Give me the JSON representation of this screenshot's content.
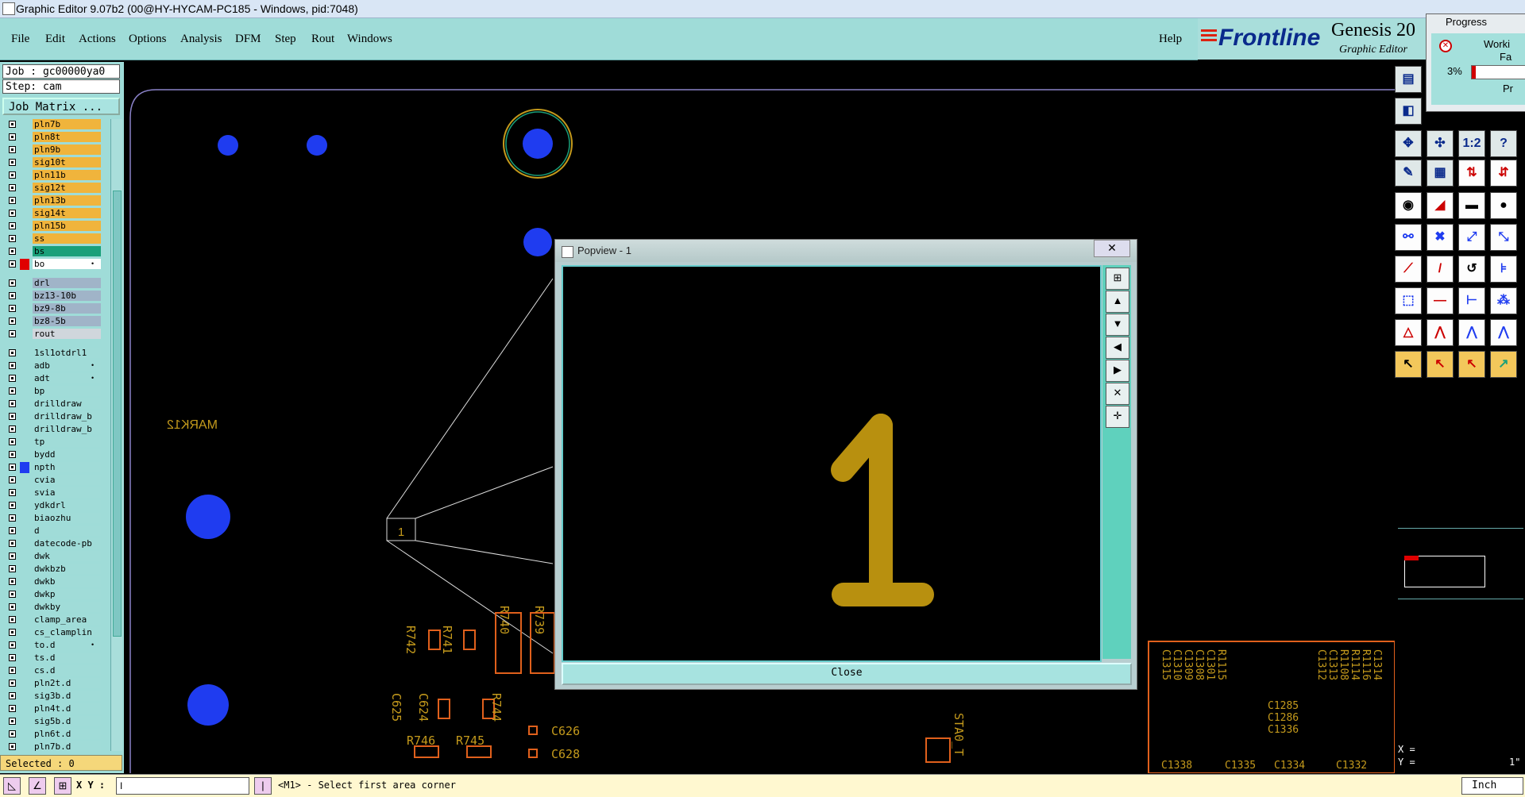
{
  "window": {
    "title": "Graphic Editor 9.07b2 (00@HY-HYCAM-PC185 - Windows, pid:7048)"
  },
  "menu": {
    "items": [
      "File",
      "Edit",
      "Actions",
      "Options",
      "Analysis",
      "DFM",
      "Step",
      "Rout",
      "Windows"
    ],
    "help": "Help"
  },
  "brand": {
    "frontline": "Frontline",
    "genesis": "Genesis 20",
    "subtitle": "Graphic Editor"
  },
  "job": {
    "job_line": "Job : gc00000ya0",
    "step_line": "Step: cam",
    "matrix_button": "Job Matrix ..."
  },
  "layers": [
    {
      "name": "pln7b",
      "color": "#f0b43c"
    },
    {
      "name": "pln8t",
      "color": "#f0b43c"
    },
    {
      "name": "pln9b",
      "color": "#f0b43c"
    },
    {
      "name": "sig10t",
      "color": "#f0b43c"
    },
    {
      "name": "pln11b",
      "color": "#f0b43c"
    },
    {
      "name": "sig12t",
      "color": "#f0b43c"
    },
    {
      "name": "pln13b",
      "color": "#f0b43c"
    },
    {
      "name": "sig14t",
      "color": "#f0b43c"
    },
    {
      "name": "pln15b",
      "color": "#f0b43c"
    },
    {
      "name": "ss",
      "color": "#f0b43c"
    },
    {
      "name": "bs",
      "color": "#1aa07a"
    },
    {
      "name": "bo",
      "color": "#ffffff",
      "swatch": "#e00000",
      "mark": "•"
    },
    {
      "gap": true
    },
    {
      "name": "drl",
      "color": "#a0b4c8"
    },
    {
      "name": "bz13-10b",
      "color": "#a0b4c8"
    },
    {
      "name": "bz9-8b",
      "color": "#a0b4c8"
    },
    {
      "name": "bz8-5b",
      "color": "#a0b4c8"
    },
    {
      "name": "rout",
      "color": "#d0d6dc"
    },
    {
      "gap": true
    },
    {
      "name": "1sl1otdrl1",
      "color": "#a0dcd8"
    },
    {
      "name": "adb",
      "color": "#a0dcd8",
      "mark": "•"
    },
    {
      "name": "adt",
      "color": "#a0dcd8",
      "mark": "•"
    },
    {
      "name": "bp",
      "color": "#a0dcd8"
    },
    {
      "name": "drilldraw",
      "color": "#a0dcd8"
    },
    {
      "name": "drilldraw_b",
      "color": "#a0dcd8"
    },
    {
      "name": "drilldraw_b",
      "color": "#a0dcd8"
    },
    {
      "name": "tp",
      "color": "#a0dcd8"
    },
    {
      "name": "bydd",
      "color": "#a0dcd8"
    },
    {
      "name": "npth",
      "color": "#a0dcd8",
      "swatch": "#1f3cf0"
    },
    {
      "name": "cvia",
      "color": "#a0dcd8"
    },
    {
      "name": "svia",
      "color": "#a0dcd8"
    },
    {
      "name": "ydkdrl",
      "color": "#a0dcd8"
    },
    {
      "name": "biaozhu",
      "color": "#a0dcd8"
    },
    {
      "name": "d",
      "color": "#a0dcd8"
    },
    {
      "name": "datecode-pb",
      "color": "#a0dcd8"
    },
    {
      "name": "dwk",
      "color": "#a0dcd8"
    },
    {
      "name": "dwkbzb",
      "color": "#a0dcd8"
    },
    {
      "name": "dwkb",
      "color": "#a0dcd8"
    },
    {
      "name": "dwkp",
      "color": "#a0dcd8"
    },
    {
      "name": "dwkby",
      "color": "#a0dcd8"
    },
    {
      "name": "clamp_area",
      "color": "#a0dcd8"
    },
    {
      "name": "cs_clamplin",
      "color": "#a0dcd8"
    },
    {
      "name": "to.d",
      "color": "#a0dcd8",
      "mark": "•"
    },
    {
      "name": "ts.d",
      "color": "#a0dcd8"
    },
    {
      "name": "cs.d",
      "color": "#a0dcd8"
    },
    {
      "name": "pln2t.d",
      "color": "#a0dcd8"
    },
    {
      "name": "sig3b.d",
      "color": "#a0dcd8"
    },
    {
      "name": "pln4t.d",
      "color": "#a0dcd8"
    },
    {
      "name": "sig5b.d",
      "color": "#a0dcd8"
    },
    {
      "name": "pln6t.d",
      "color": "#a0dcd8"
    },
    {
      "name": "pln7b.d",
      "color": "#a0dcd8"
    }
  ],
  "selected": "Selected : 0",
  "canvas": {
    "mark_text": "MARK12",
    "pad_number": "1",
    "labels": [
      "R740",
      "R739",
      "R742",
      "R741",
      "R744",
      "C625",
      "C624",
      "R746",
      "R745",
      "C626",
      "C628",
      "C1285",
      "C1286",
      "C1335",
      "C1334",
      "C1332",
      "C1336",
      "C1338",
      "C1315",
      "C1310",
      "C1309",
      "C1308",
      "C1301",
      "R1115",
      "R1108",
      "R1114",
      "R1116",
      "C1312",
      "C1313",
      "C1314",
      "STA0_T"
    ]
  },
  "popview": {
    "title": "Popview - 1",
    "close_x": "✕",
    "digit": "1",
    "close_button": "Close"
  },
  "progress": {
    "title": "Progress",
    "line1": "Worki",
    "line2": "Fa",
    "percent": "3%",
    "line3": "Pr"
  },
  "statusbar": {
    "xy_label": "X Y :",
    "xy_value": "I",
    "message": "<M1> - Select first area corner",
    "units": "Inch"
  },
  "coords": {
    "x_label": "X =",
    "y_label": "Y =",
    "y_value": "1\""
  },
  "colors": {
    "panel": "#9fdcd8",
    "signal": "#f0b43c",
    "drill_blue": "#1f3cf0",
    "silkscreen": "#c49a1c"
  }
}
